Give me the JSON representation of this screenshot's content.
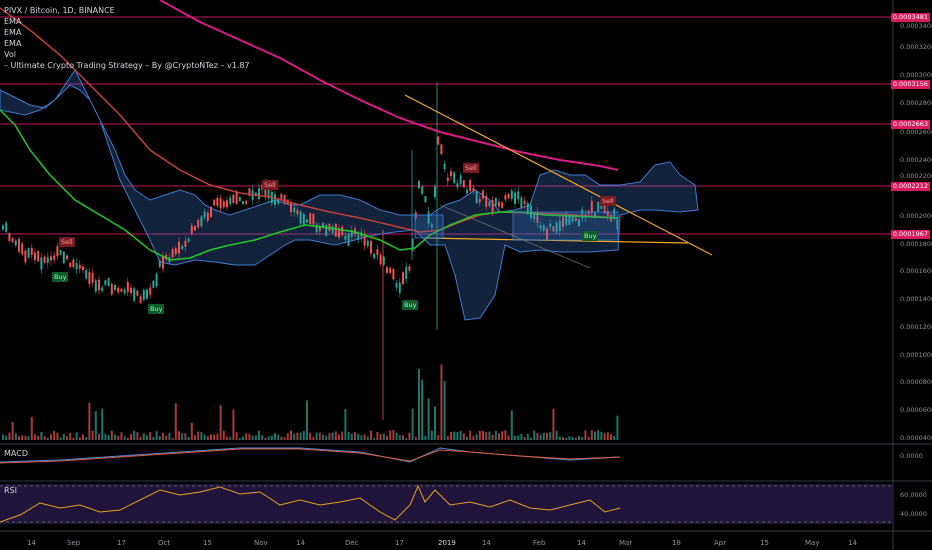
{
  "header": {
    "title": "PIVX / Bitcoin, 1D, BINANCE",
    "indicators": [
      "EMA",
      "EMA",
      "EMA",
      "Vol",
      "– Ultimate Crypto Trading Strategy – By @CryptoNTez – v1.87"
    ]
  },
  "panes": {
    "macd_label": "MACD",
    "rsi_label": "RSI"
  },
  "price_axis": {
    "labels": [
      "0.0003400",
      "0.0003200",
      "0.0003000",
      "0.0002800",
      "0.0002600",
      "0.0002400",
      "0.0002200",
      "0.0002000",
      "0.0001800",
      "0.0001600",
      "0.0001400",
      "0.0001200",
      "0.0001000",
      "0.0000800",
      "0.0000600",
      "0.0000400"
    ],
    "macd_labels": [
      "0.0000"
    ],
    "rsi_labels": [
      "60.0000",
      "40.0000"
    ]
  },
  "price_tags": [
    "0.0003481",
    "0.0003156",
    "0.0002663",
    "0.0002212",
    "0.0001967"
  ],
  "time_axis": [
    "14",
    "Sep",
    "17",
    "Oct",
    "15",
    "Nov",
    "14",
    "Dec",
    "17",
    "2019",
    "14",
    "Feb",
    "14",
    "Mar",
    "18",
    "Apr",
    "15",
    "May",
    "14"
  ],
  "signals": [
    {
      "text": "Sell",
      "type": "sell"
    },
    {
      "text": "Buy",
      "type": "buy"
    },
    {
      "text": "Buy",
      "type": "buy"
    },
    {
      "text": "Sell",
      "type": "sell"
    },
    {
      "text": "Sell",
      "type": "sell"
    },
    {
      "text": "Buy",
      "type": "buy"
    },
    {
      "text": "Sell",
      "type": "sell"
    },
    {
      "text": "Buy",
      "type": "buy"
    }
  ],
  "colors": {
    "up": "#26a69a",
    "down": "#ef5350",
    "cloud": "#3d7bd1",
    "ema_green": "#22c72a",
    "ema_red": "#c2403a",
    "ema_magenta": "#d81b8a",
    "trendline": "#f5a623",
    "hline": "#c2185b",
    "rsi_bg": "#21143a",
    "rsi_line": "#e0a020"
  }
}
